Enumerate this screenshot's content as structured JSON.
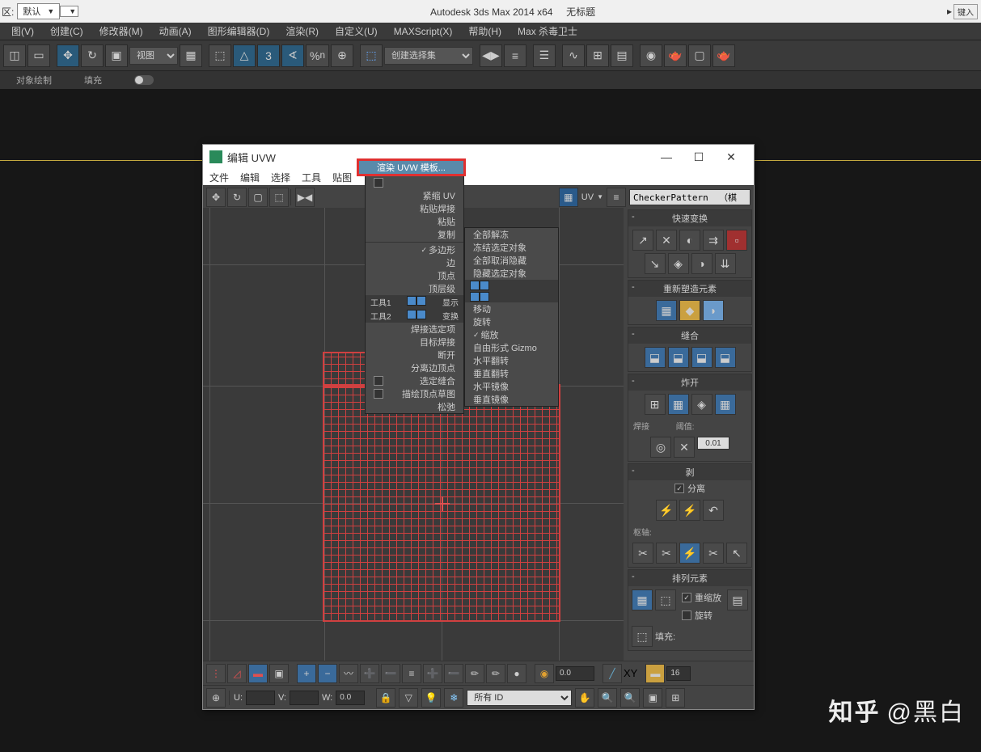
{
  "title": {
    "dropdown_label": "区:",
    "dropdown_value": "默认",
    "app": "Autodesk 3ds Max  2014 x64",
    "doc": "无标题",
    "right_btn": "键入"
  },
  "mainmenu": [
    "图(V)",
    "创建(C)",
    "修改器(M)",
    "动画(A)",
    "图形编辑器(D)",
    "渲染(R)",
    "自定义(U)",
    "MAXScript(X)",
    "帮助(H)",
    "Max 杀毒卫士"
  ],
  "toolbar": {
    "viewsel": "视图",
    "selectset": "创建选择集"
  },
  "subtoolbar": {
    "a": "对象绘制",
    "b": "填充"
  },
  "uvw": {
    "title": "编辑 UVW",
    "menu": [
      "文件",
      "编辑",
      "选择",
      "工具",
      "贴图"
    ],
    "highlight": "渲染 UVW 模板...",
    "uv_label": "UV",
    "texture": "CheckerPattern  （棋",
    "ctx1": [
      "紧缩 UV",
      "粘贴焊接",
      "粘贴",
      "复制"
    ],
    "ctx1b": [
      "多边形",
      "边",
      "顶点",
      "顶层级"
    ],
    "ctx1_tool1": "工具1",
    "ctx1_tool2": "工具2",
    "ctx1_disp": "显示",
    "ctx1_trans": "变换",
    "ctx1c": [
      "焊接选定项",
      "目标焊接",
      "断开",
      "分离边顶点",
      "选定缝合",
      "描绘顶点草图",
      "松弛"
    ],
    "ctx2a": [
      "全部解冻",
      "冻结选定对象",
      "全部取消隐藏",
      "隐藏选定对象"
    ],
    "ctx2b": [
      "移动",
      "旋转",
      "缩放",
      "自由形式 Gizmo",
      "水平翻转",
      "垂直翻转",
      "水平镜像",
      "垂直镜像"
    ],
    "panels": {
      "p1": "快速变换",
      "p2": "重新塑造元素",
      "p3": "缝合",
      "p4": "炸开",
      "p4_weld": "焊接",
      "p4_thresh": "阈值:",
      "p4_val": "0.01",
      "p5": "剥",
      "p5_sep": "分离",
      "p5_pivot": "枢轴:",
      "p6": "排列元素",
      "p6_rescale": "重缩放",
      "p6_rotate": "旋转",
      "p6_fill": "填充:"
    },
    "bottom": {
      "val0": "0.0",
      "xy": "XY",
      "num16": "16",
      "u": "U:",
      "v": "V:",
      "w": "W:",
      "wval": "0.0",
      "all": "所有",
      "id": "ID"
    }
  },
  "watermark": {
    "logo": "知乎",
    "author": "@黑白"
  }
}
